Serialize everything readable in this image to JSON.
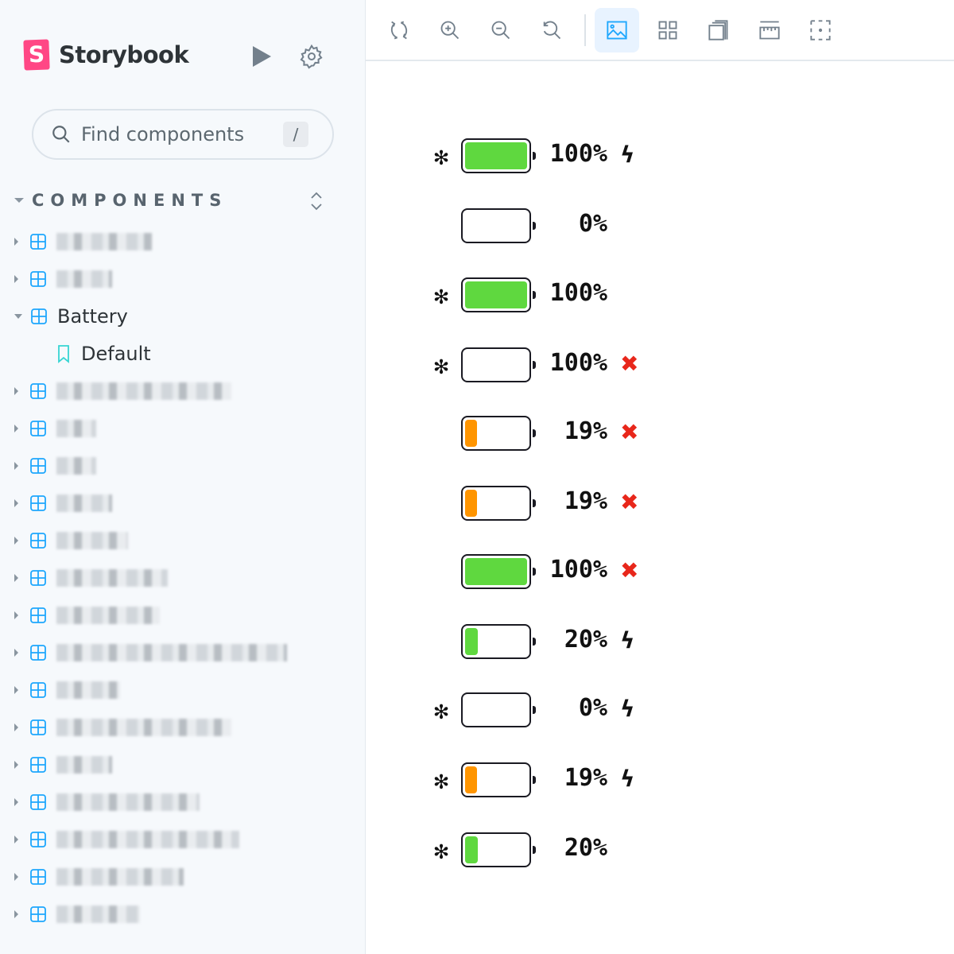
{
  "sidebar": {
    "brand": "Storybook",
    "logo_letter": "S",
    "search_placeholder": "Find components",
    "search_shortcut": "/",
    "section_label": "COMPONENTS",
    "expanded_component": "Battery",
    "story": "Default",
    "blurred_item_count": 18
  },
  "toolbar": {
    "icons": [
      "reload-icon",
      "zoom-in-icon",
      "zoom-out-icon",
      "zoom-reset-icon",
      "background-image-icon",
      "grid-icon",
      "viewport-icon",
      "ruler-icon",
      "outline-icon"
    ],
    "active": "background-image-icon"
  },
  "colors": {
    "green": "#5fd83f",
    "orange": "#ff9500",
    "cross": "#e8271b",
    "accent": "#1ea7fd"
  },
  "batteries": [
    {
      "star": true,
      "level": 100,
      "color": "green",
      "label": "100%",
      "status": "charging"
    },
    {
      "star": false,
      "level": 0,
      "color": "none",
      "label": "0%",
      "status": "none"
    },
    {
      "star": true,
      "level": 100,
      "color": "green",
      "label": "100%",
      "status": "none"
    },
    {
      "star": true,
      "level": 0,
      "color": "none",
      "label": "100%",
      "status": "error"
    },
    {
      "star": false,
      "level": 19,
      "color": "orange",
      "label": "19%",
      "status": "error"
    },
    {
      "star": false,
      "level": 19,
      "color": "orange",
      "label": "19%",
      "status": "error"
    },
    {
      "star": false,
      "level": 100,
      "color": "green",
      "label": "100%",
      "status": "error"
    },
    {
      "star": false,
      "level": 20,
      "color": "green",
      "label": "20%",
      "status": "charging"
    },
    {
      "star": true,
      "level": 0,
      "color": "none",
      "label": "0%",
      "status": "charging"
    },
    {
      "star": true,
      "level": 19,
      "color": "orange",
      "label": "19%",
      "status": "charging"
    },
    {
      "star": true,
      "level": 20,
      "color": "green",
      "label": "20%",
      "status": "none"
    }
  ]
}
